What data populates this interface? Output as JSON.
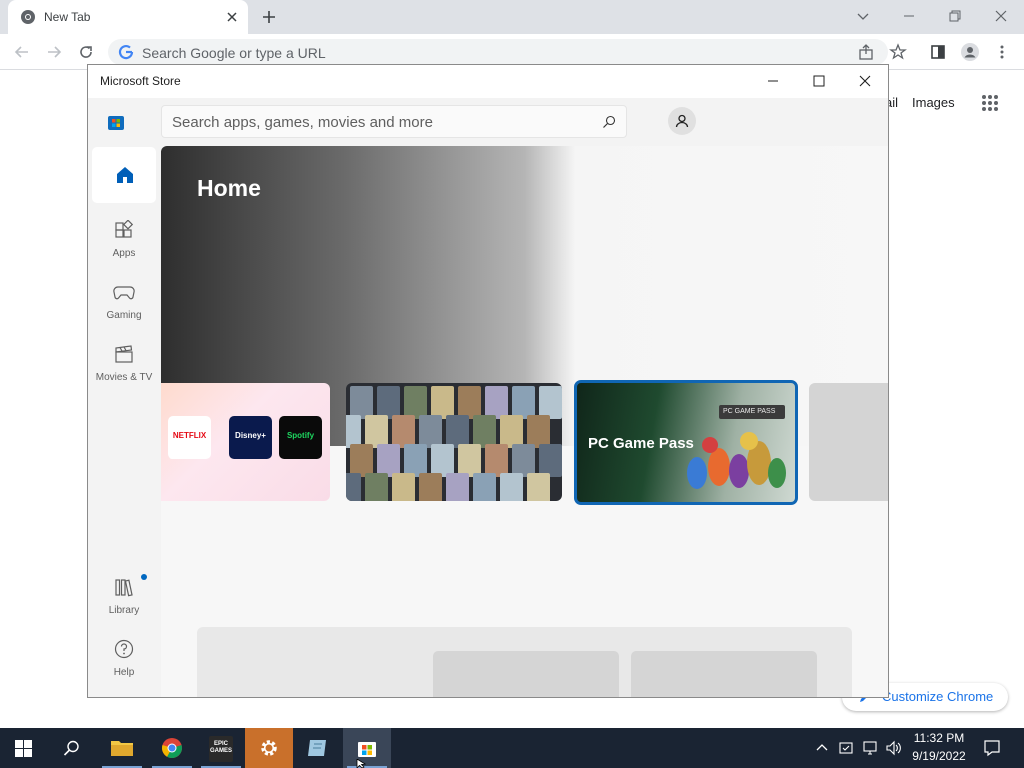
{
  "browser": {
    "tab_title": "New Tab",
    "omnibox_placeholder": "Search Google or type a URL",
    "ntp_gmail": "Gmail",
    "ntp_images": "Images",
    "customize_label": "Customize Chrome"
  },
  "store": {
    "window_title": "Microsoft Store",
    "search_placeholder": "Search apps, games, movies and more",
    "nav": {
      "apps": "Apps",
      "gaming": "Gaming",
      "movies_tv": "Movies & TV",
      "library": "Library",
      "help": "Help"
    },
    "hero_title": "Home",
    "cards": {
      "netflix": "NETFLIX",
      "disney": "Disney+",
      "spotify": "Spotify",
      "gamepass_title": "PC Game Pass",
      "gamepass_badge": "PC GAME PASS"
    }
  },
  "taskbar": {
    "time": "11:32 PM",
    "date": "9/19/2022",
    "epic_label": "EPIC GAMES"
  },
  "colors": {
    "accent": "#005fb8",
    "gamepass_border": "#1066b4",
    "taskbar": "#1a2433"
  }
}
